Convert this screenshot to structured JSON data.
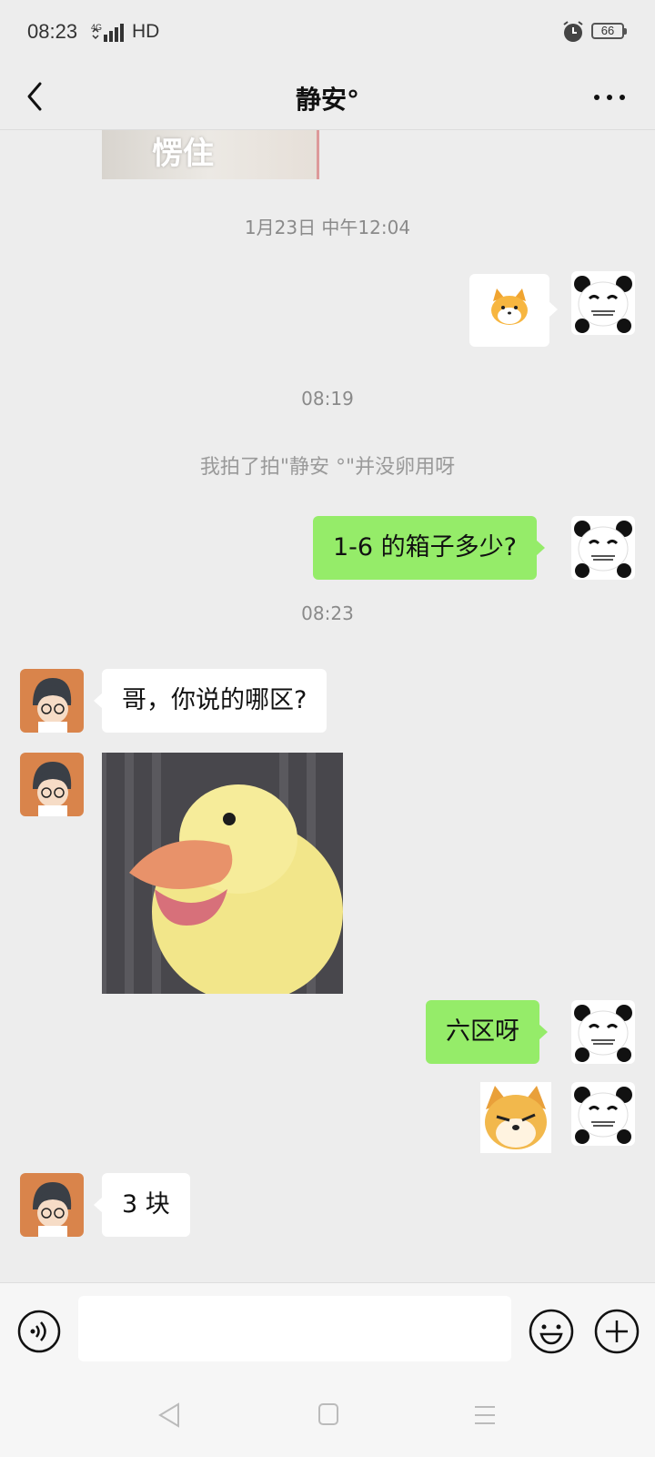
{
  "status_bar": {
    "time": "08:23",
    "network": "4G",
    "hd": "HD",
    "battery": "66"
  },
  "header": {
    "title": "静安°"
  },
  "messages": {
    "top_image_caption": "愣住",
    "time1": "1月23日 中午12:04",
    "time2": "08:19",
    "system_pat": "我拍了拍\"静安 °\"并没卵用呀",
    "out1": "1-6 的箱子多少?",
    "time3": "08:23",
    "in1": "哥，你说的哪区?",
    "out2": "六区呀",
    "in2": "3 块"
  },
  "input": {
    "placeholder": ""
  },
  "colors": {
    "outgoing_bubble": "#95ec69",
    "incoming_bubble": "#ffffff",
    "background": "#ededed"
  },
  "icons": [
    "back-arrow-icon",
    "more-icon",
    "voice-icon",
    "emoji-icon",
    "plus-icon",
    "nav-back-icon",
    "nav-home-icon",
    "nav-menu-icon",
    "alarm-icon",
    "signal-icon"
  ]
}
